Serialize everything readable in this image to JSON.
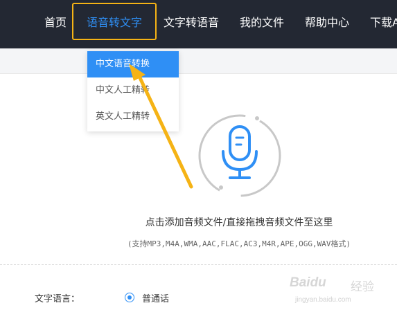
{
  "nav": {
    "items": [
      {
        "label": "首页"
      },
      {
        "label": "语音转文字"
      },
      {
        "label": "文字转语音"
      },
      {
        "label": "我的文件"
      },
      {
        "label": "帮助中心"
      },
      {
        "label": "下载A"
      }
    ]
  },
  "dropdown": {
    "items": [
      {
        "label": "中文语音转换"
      },
      {
        "label": "中文人工精转"
      },
      {
        "label": "英文人工精转"
      }
    ]
  },
  "upload": {
    "instruction": "点击添加音频文件/直接拖拽音频文件至这里",
    "formats": "(支持MP3,M4A,WMA,AAC,FLAC,AC3,M4R,APE,OGG,WAV格式)"
  },
  "language": {
    "label": "文字语言：",
    "selected": "普通话"
  },
  "watermark": {
    "brand": "Baidu",
    "brand_cn": "经验",
    "url": "jingyan.baidu.com"
  },
  "colors": {
    "accent": "#2f8ff5",
    "highlight": "#f5b315",
    "topbar": "#232833"
  }
}
